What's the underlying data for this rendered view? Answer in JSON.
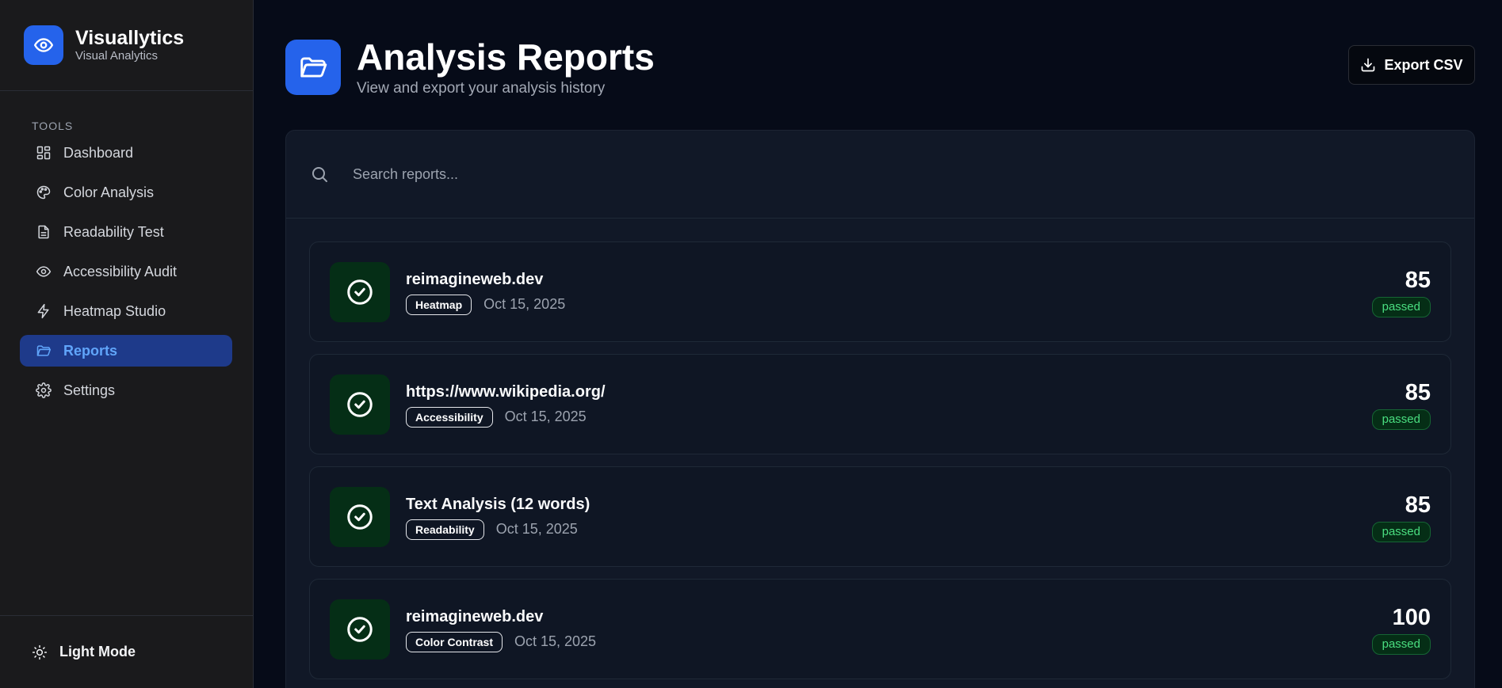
{
  "brand": {
    "name": "Visuallytics",
    "subtitle": "Visual Analytics"
  },
  "sidebar": {
    "section_label": "TOOLS",
    "items": [
      {
        "label": "Dashboard",
        "icon": "dashboard-icon"
      },
      {
        "label": "Color Analysis",
        "icon": "palette-icon"
      },
      {
        "label": "Readability Test",
        "icon": "document-icon"
      },
      {
        "label": "Accessibility Audit",
        "icon": "eye-icon"
      },
      {
        "label": "Heatmap Studio",
        "icon": "lightning-icon"
      },
      {
        "label": "Reports",
        "icon": "folder-icon",
        "active": true
      },
      {
        "label": "Settings",
        "icon": "gear-icon"
      }
    ],
    "footer_label": "Light Mode"
  },
  "header": {
    "title": "Analysis Reports",
    "subtitle": "View and export your analysis history",
    "export_label": "Export CSV"
  },
  "search": {
    "placeholder": "Search reports..."
  },
  "reports": [
    {
      "title": "reimagineweb.dev",
      "tag": "Heatmap",
      "date": "Oct 15, 2025",
      "score": "85",
      "status": "passed"
    },
    {
      "title": "https://www.wikipedia.org/",
      "tag": "Accessibility",
      "date": "Oct 15, 2025",
      "score": "85",
      "status": "passed"
    },
    {
      "title": "Text Analysis (12 words)",
      "tag": "Readability",
      "date": "Oct 15, 2025",
      "score": "85",
      "status": "passed"
    },
    {
      "title": "reimagineweb.dev",
      "tag": "Color Contrast",
      "date": "Oct 15, 2025",
      "score": "100",
      "status": "passed"
    }
  ],
  "colors": {
    "accent": "#2563eb",
    "active_nav_bg": "#1e3a8a",
    "active_nav_text": "#60a5fa",
    "passed_text": "#4ade80",
    "passed_bg": "#052e16"
  }
}
